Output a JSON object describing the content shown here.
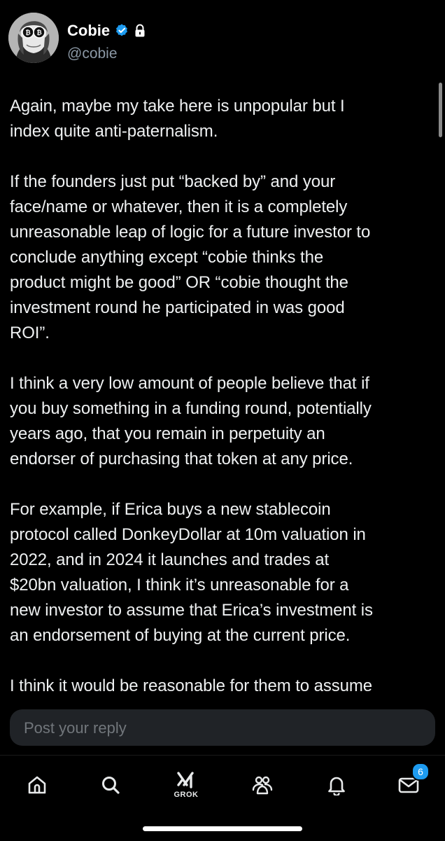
{
  "author": {
    "display_name": "Cobie",
    "handle": "@cobie",
    "verified": true,
    "protected": true
  },
  "post": {
    "paragraphs": [
      "Again, maybe my take here is unpopular but I\nindex quite anti-paternalism.",
      "If the founders just put “backed by” and your\nface/name or whatever, then it is a completely\nunreasonable leap of logic for a future investor to\nconclude anything except “cobie thinks the\nproduct might be good” OR “cobie thought the\ninvestment round he participated in was good\nROI”.",
      "I think a very low amount of people believe that if\nyou buy something in a funding round, potentially\nyears ago, that you remain in perpetuity an\nendorser of purchasing that token at any price.",
      "For example, if Erica buys a new stablecoin\nprotocol called DonkeyDollar at 10m valuation in\n2022, and in 2024 it launches and trades at\n$20bn valuation, I think it’s unreasonable for a\nnew investor to assume that Erica’s investment is\nan endorsement of buying at the current price.",
      "I think it would be reasonable for them to assume"
    ]
  },
  "reply": {
    "placeholder": "Post your reply"
  },
  "nav": {
    "items": [
      {
        "icon": "home-icon"
      },
      {
        "icon": "search-icon"
      },
      {
        "icon": "grok-icon",
        "label": "GROK"
      },
      {
        "icon": "communities-icon"
      },
      {
        "icon": "notifications-icon"
      },
      {
        "icon": "messages-icon",
        "badge": "6"
      }
    ]
  },
  "colors": {
    "background": "#000000",
    "text": "#e7e9ea",
    "secondary_text": "#8b98a5",
    "accent": "#1d9bf0",
    "reply_field": "#202327"
  }
}
